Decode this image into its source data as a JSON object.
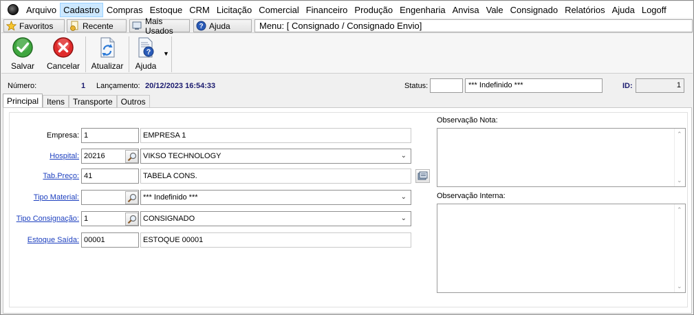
{
  "menu": {
    "items": [
      "Arquivo",
      "Cadastro",
      "Compras",
      "Estoque",
      "CRM",
      "Licitação",
      "Comercial",
      "Financeiro",
      "Produção",
      "Engenharia",
      "Anvisa",
      "Vale",
      "Consignado",
      "Relatórios",
      "Ajuda",
      "Logoff"
    ],
    "active": "Cadastro"
  },
  "shortcuts": {
    "favoritos": "Favoritos",
    "recente": "Recente",
    "mais_usados": "Mais Usados",
    "ajuda": "Ajuda",
    "menu_path": "Menu: [ Consignado / Consignado Envio]"
  },
  "toolbar": {
    "salvar": "Salvar",
    "cancelar": "Cancelar",
    "atualizar": "Atualizar",
    "ajuda": "Ajuda"
  },
  "info": {
    "numero_label": "Número:",
    "numero_value": "1",
    "lancamento_label": "Lançamento:",
    "lancamento_value": "20/12/2023 16:54:33",
    "status_label": "Status:",
    "status_code": "",
    "status_text": "*** Indefinido ***",
    "id_label": "ID:",
    "id_value": "1"
  },
  "tabs": [
    "Principal",
    "Itens",
    "Transporte",
    "Outros"
  ],
  "form": {
    "empresa": {
      "label": "Empresa:",
      "code": "1",
      "name": "EMPRESA 1"
    },
    "hospital": {
      "label": "Hospital:",
      "code": "20216",
      "name": "VIKSO TECHNOLOGY"
    },
    "tab_preco": {
      "label": "Tab.Preço:",
      "code": "41",
      "name": "TABELA CONS."
    },
    "tipo_material": {
      "label": "Tipo Material:",
      "code": "",
      "name": "*** Indefinido ***"
    },
    "tipo_consignacao": {
      "label": "Tipo Consignação:",
      "code": "1",
      "name": "CONSIGNADO"
    },
    "estoque_saida": {
      "label": "Estoque Saída:",
      "code": "00001",
      "name": "ESTOQUE 00001"
    }
  },
  "observacoes": {
    "nota_label": "Observação Nota:",
    "nota_value": "",
    "interna_label": "Observação Interna:",
    "interna_value": ""
  },
  "colors": {
    "accent_link": "#1c3fbf",
    "value_text": "#1a1a6e",
    "menu_highlight": "#cce8ff"
  }
}
